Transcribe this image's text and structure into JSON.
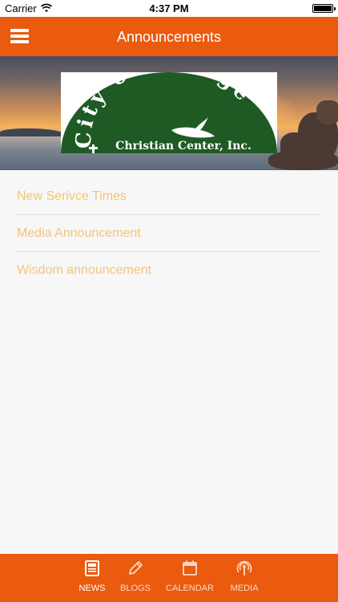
{
  "status_bar": {
    "carrier": "Carrier",
    "time": "4:37 PM"
  },
  "header": {
    "title": "Announcements"
  },
  "banner": {
    "logo_arc_text": "City of Refuge",
    "logo_subtitle": "Christian Center, Inc."
  },
  "announcements": [
    {
      "title": "New Serivce Times"
    },
    {
      "title": "Media Announcement"
    },
    {
      "title": "Wisdom announcement"
    }
  ],
  "tabs": [
    {
      "label": "NEWS",
      "icon": "news-icon",
      "active": true
    },
    {
      "label": "BLOGS",
      "icon": "pencil-icon",
      "active": false
    },
    {
      "label": "CALENDAR",
      "icon": "calendar-icon",
      "active": false
    },
    {
      "label": "MEDIA",
      "icon": "podcast-icon",
      "active": false
    }
  ],
  "colors": {
    "brand": "#ea5a0f",
    "link_text": "#f2c57a",
    "logo_green": "#1f5a24"
  }
}
